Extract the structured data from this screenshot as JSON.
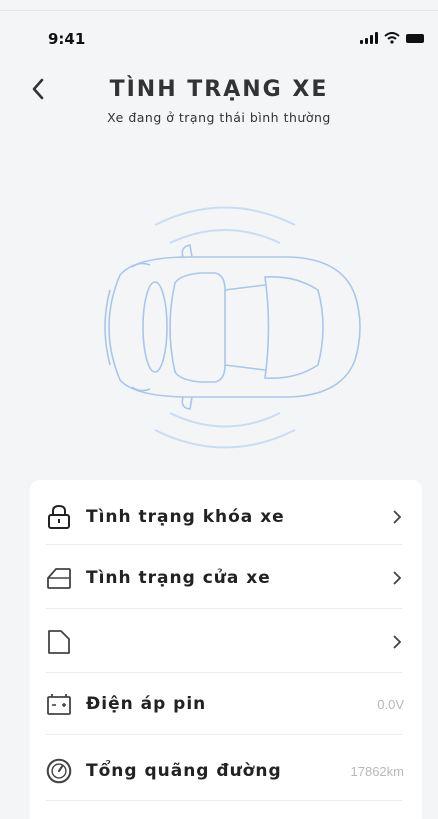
{
  "status_bar": {
    "time": "9:41"
  },
  "header": {
    "title": "TÌNH TRẠNG XE",
    "subtitle": "Xe đang ở trạng thái bình thường"
  },
  "items": [
    {
      "label": "Tình trạng khóa xe",
      "icon": "lock-icon"
    },
    {
      "label": "Tình trạng cửa xe",
      "icon": "car-door-icon"
    },
    {
      "label": "",
      "icon": "window-icon"
    },
    {
      "label": "Điện áp pin",
      "value": "0.0V",
      "icon": "battery-icon"
    },
    {
      "label": "Tổng quãng đường",
      "value": "17862km",
      "icon": "odometer-icon"
    }
  ],
  "colors": {
    "background": "#f4f5f7",
    "car_outline": "#a9c6ea",
    "panel": "#ffffff"
  }
}
